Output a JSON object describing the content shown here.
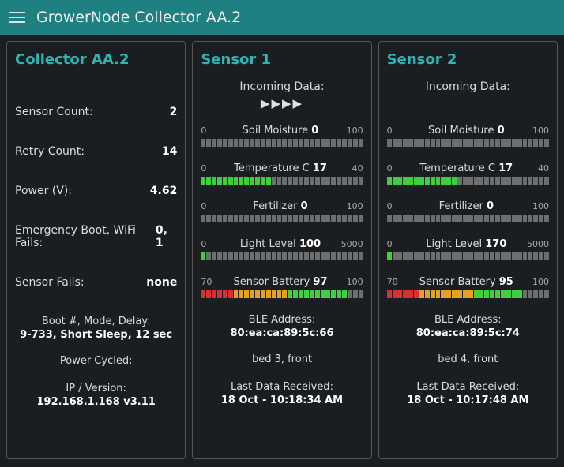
{
  "header": {
    "title": "GrowerNode Collector AA.2"
  },
  "collector": {
    "title": "Collector AA.2",
    "stats": {
      "sensor_count_label": "Sensor Count:",
      "sensor_count_value": "2",
      "retry_count_label": "Retry Count:",
      "retry_count_value": "14",
      "power_label": "Power (V):",
      "power_value": "4.62",
      "emergency_label": "Emergency Boot, WiFi Fails:",
      "emergency_value": "0, 1",
      "fails_label": "Sensor Fails:",
      "fails_value": "none"
    },
    "boot_label": "Boot #, Mode, Delay:",
    "boot_value": "9-733, Short Sleep, 12 sec",
    "power_cycled_label": "Power Cycled:",
    "power_cycled_value": "",
    "ip_label": "IP / Version:",
    "ip_value": "192.168.1.168 v3.11"
  },
  "sensors": [
    {
      "title": "Sensor 1",
      "incoming_label": "Incoming Data:",
      "show_arrows": true,
      "gauges": [
        {
          "name": "Soil Moisture",
          "value": 0,
          "min": 0,
          "max": 100
        },
        {
          "name": "Temperature C",
          "value": 17,
          "min": 0,
          "max": 40
        },
        {
          "name": "Fertilizer",
          "value": 0,
          "min": 0,
          "max": 100
        },
        {
          "name": "Light Level",
          "value": 100,
          "min": 0,
          "max": 5000
        },
        {
          "name": "Sensor Battery",
          "value": 97,
          "min": 70,
          "max": 100,
          "scheme": "battery"
        }
      ],
      "ble_label": "BLE Address:",
      "ble_value": "80:ea:ca:89:5c:66",
      "location": "bed 3, front",
      "last_label": "Last Data Received:",
      "last_value": "18 Oct - 10:18:34 AM"
    },
    {
      "title": "Sensor 2",
      "incoming_label": "Incoming Data:",
      "show_arrows": false,
      "gauges": [
        {
          "name": "Soil Moisture",
          "value": 0,
          "min": 0,
          "max": 100
        },
        {
          "name": "Temperature C",
          "value": 17,
          "min": 0,
          "max": 40
        },
        {
          "name": "Fertilizer",
          "value": 0,
          "min": 0,
          "max": 100
        },
        {
          "name": "Light Level",
          "value": 170,
          "min": 0,
          "max": 5000
        },
        {
          "name": "Sensor Battery",
          "value": 95,
          "min": 70,
          "max": 100,
          "scheme": "battery"
        }
      ],
      "ble_label": "BLE Address:",
      "ble_value": "80:ea:ca:89:5c:74",
      "location": "bed 4, front",
      "last_label": "Last Data Received:",
      "last_value": "18 Oct - 10:17:48 AM"
    }
  ]
}
